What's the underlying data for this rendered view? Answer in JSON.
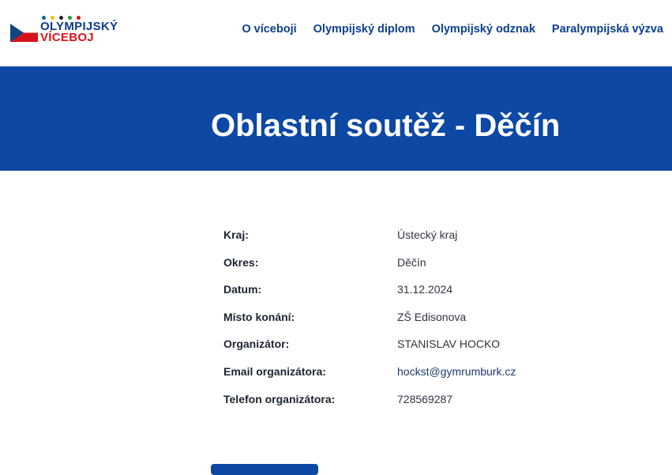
{
  "logo": {
    "line1": "OLYMPIJSKÝ",
    "line2": "VÍCEBOJ",
    "dot_colors": [
      "#0b5fb0",
      "#f5c400",
      "#222222",
      "#1f9d3a",
      "#d7141a"
    ]
  },
  "nav": {
    "items": [
      {
        "label": "O víceboji"
      },
      {
        "label": "Olympijský diplom"
      },
      {
        "label": "Olympijský odznak"
      },
      {
        "label": "Paralympijská výzva"
      }
    ]
  },
  "banner": {
    "title": "Oblastní soutěž - Děčín",
    "background": "#0c48a4"
  },
  "details": {
    "rows": [
      {
        "label": "Kraj:",
        "value": "Ústecký kraj"
      },
      {
        "label": "Okres:",
        "value": "Děčín"
      },
      {
        "label": "Datum:",
        "value": "31.12.2024"
      },
      {
        "label": "Místo konání:",
        "value": "ZŠ Edisonova"
      },
      {
        "label": "Organizátor:",
        "value": "STANISLAV HOCKO"
      },
      {
        "label": "Email organizátora:",
        "value": "hockst@gymrumburk.cz"
      },
      {
        "label": "Telefon organizátora:",
        "value": "728569287"
      }
    ]
  }
}
